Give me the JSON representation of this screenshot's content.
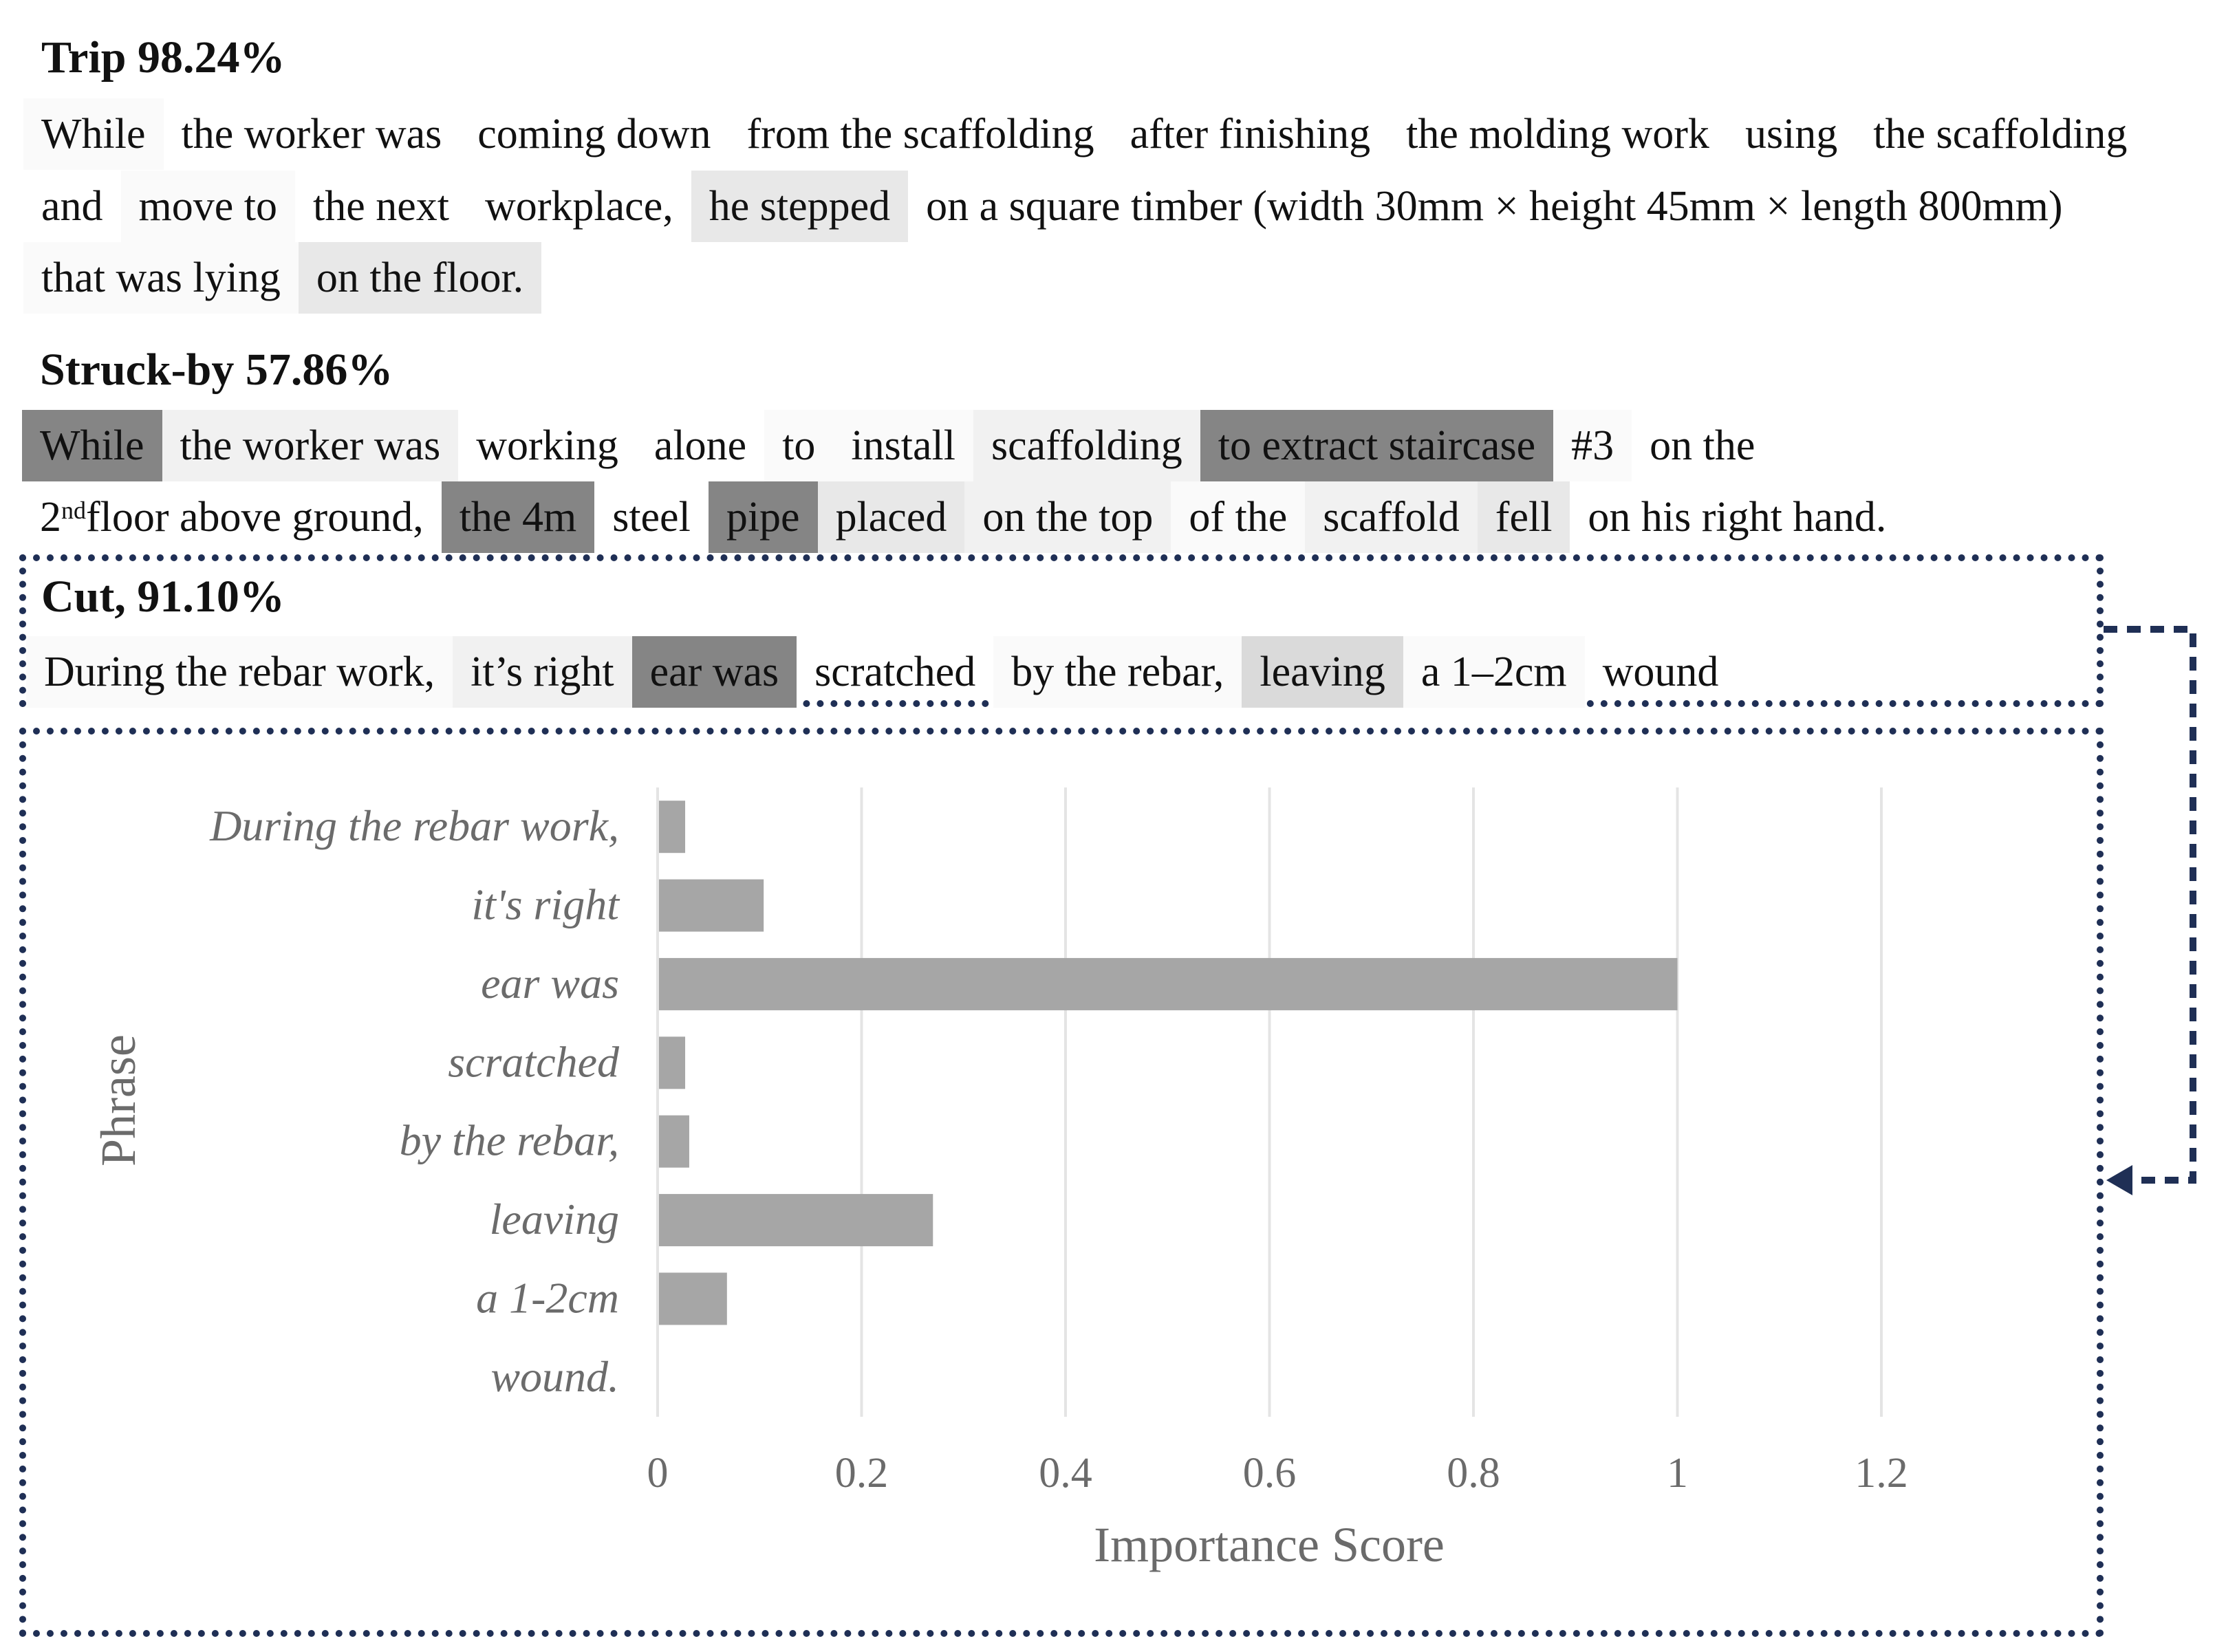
{
  "colors": {
    "frame": "#1f2f55",
    "bar": "#a6a6a6",
    "grid": "#e4e4e4",
    "axis_text": "#6b6b6b",
    "shade": {
      "none": "transparent",
      "vlight": "#fafafa",
      "light": "#f1f1f1",
      "mid": "#e8e8e8",
      "midd": "#dadada",
      "dark": "#858585"
    }
  },
  "sections": [
    {
      "id": "trip",
      "title": "Trip 98.24%",
      "rows": [
        [
          {
            "text": "While",
            "shade": "vlight"
          },
          {
            "text": "the worker was",
            "shade": "none"
          },
          {
            "text": "coming down",
            "shade": "none"
          },
          {
            "text": "from the scaffolding",
            "shade": "none"
          },
          {
            "text": "after finishing",
            "shade": "none"
          },
          {
            "text": "the molding work",
            "shade": "none"
          },
          {
            "text": "using",
            "shade": "none"
          },
          {
            "text": "the scaffolding",
            "shade": "none"
          }
        ],
        [
          {
            "text": "and",
            "shade": "none"
          },
          {
            "text": "move to",
            "shade": "vlight"
          },
          {
            "text": "the next",
            "shade": "none"
          },
          {
            "text": "workplace,",
            "shade": "none"
          },
          {
            "text": "he stepped",
            "shade": "mid"
          },
          {
            "text": "on a square timber (width 30mm × height 45mm × length 800mm)",
            "shade": "none"
          }
        ],
        [
          {
            "text": "that was lying",
            "shade": "vlight"
          },
          {
            "text": "on the floor.",
            "shade": "mid"
          }
        ]
      ]
    },
    {
      "id": "struck-by",
      "title": "Struck-by 57.86%",
      "rows": [
        [
          {
            "text": "While",
            "shade": "dark"
          },
          {
            "text": "the worker was",
            "shade": "light"
          },
          {
            "text": "working",
            "shade": "none"
          },
          {
            "text": "alone",
            "shade": "none"
          },
          {
            "text": "to",
            "shade": "vlight"
          },
          {
            "text": "install",
            "shade": "vlight"
          },
          {
            "text": "scaffolding",
            "shade": "light"
          },
          {
            "text": "to  extract  staircase",
            "shade": "dark"
          },
          {
            "text": "#3",
            "shade": "vlight"
          },
          {
            "text": "on the",
            "shade": "none"
          }
        ],
        [
          {
            "text": "2",
            "sup": "nd",
            "text2": " floor above ground,",
            "shade": "none"
          },
          {
            "text": "the 4m",
            "shade": "dark"
          },
          {
            "text": "steel",
            "shade": "none"
          },
          {
            "text": "pipe",
            "shade": "dark"
          },
          {
            "text": "placed",
            "shade": "mid"
          },
          {
            "text": "on the top",
            "shade": "light"
          },
          {
            "text": "of the",
            "shade": "vlight"
          },
          {
            "text": "scaffold",
            "shade": "light"
          },
          {
            "text": "fell",
            "shade": "mid"
          },
          {
            "text": "on his right hand.",
            "shade": "none"
          }
        ]
      ]
    },
    {
      "id": "cut",
      "title": "Cut, 91.10%",
      "rows": [
        [
          {
            "text": "During the rebar work,",
            "shade": "vlight"
          },
          {
            "text": "it’s right",
            "shade": "light"
          },
          {
            "text": "ear was",
            "shade": "dark"
          },
          {
            "text": "scratched",
            "shade": "none"
          },
          {
            "text": "by the rebar,",
            "shade": "vlight"
          },
          {
            "text": "leaving",
            "shade": "midd"
          },
          {
            "text": "a 1–2cm",
            "shade": "vlight"
          },
          {
            "text": "wound",
            "shade": "none"
          }
        ]
      ]
    }
  ],
  "chart_data": {
    "type": "bar",
    "orientation": "horizontal",
    "title": "",
    "xlabel": "Importance Score",
    "ylabel": "Phrase",
    "categories": [
      "During the rebar work,",
      "it's right",
      "ear was",
      "scratched",
      "by the rebar,",
      "leaving",
      "a 1-2cm",
      "wound."
    ],
    "values": [
      0.027,
      0.104,
      1.0,
      0.027,
      0.031,
      0.27,
      0.068,
      0.0
    ],
    "xlim": [
      0,
      1.2
    ],
    "xticks": [
      "0",
      "0.2",
      "0.4",
      "0.6",
      "0.8",
      "1",
      "1.2"
    ],
    "grid": true,
    "legend": "none"
  }
}
